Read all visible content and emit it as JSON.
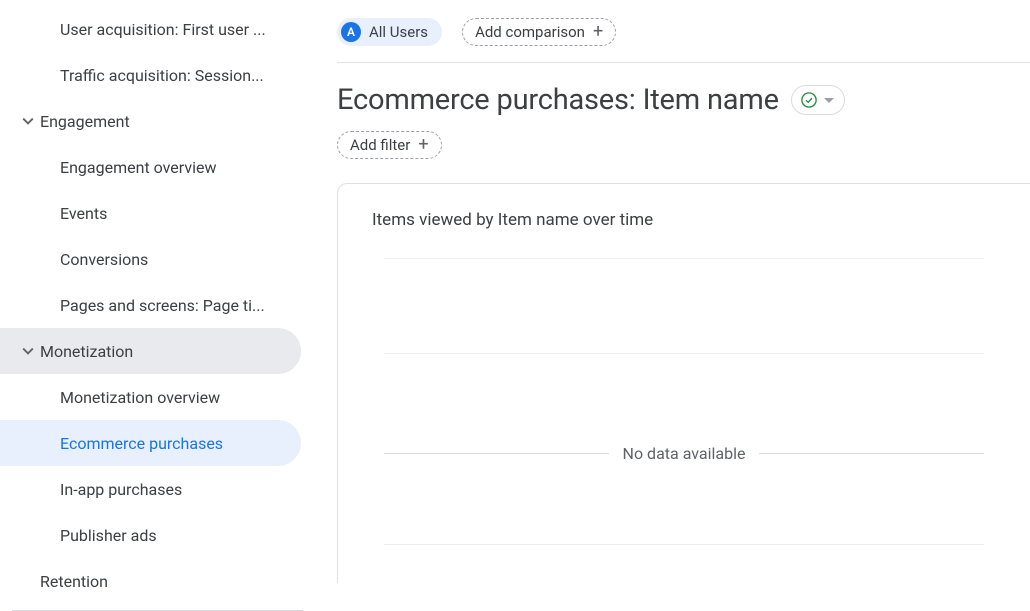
{
  "sidebar": {
    "items": [
      {
        "label": "User acquisition: First user ...",
        "level": 1
      },
      {
        "label": "Traffic acquisition: Session...",
        "level": 1
      },
      {
        "label": "Engagement",
        "level": 0,
        "expandable": true
      },
      {
        "label": "Engagement overview",
        "level": 1
      },
      {
        "label": "Events",
        "level": 1
      },
      {
        "label": "Conversions",
        "level": 1
      },
      {
        "label": "Pages and screens: Page ti...",
        "level": 1
      },
      {
        "label": "Monetization",
        "level": 0,
        "expandable": true,
        "sectionActive": true
      },
      {
        "label": "Monetization overview",
        "level": 1
      },
      {
        "label": "Ecommerce purchases",
        "level": 1,
        "active": true
      },
      {
        "label": "In-app purchases",
        "level": 1
      },
      {
        "label": "Publisher ads",
        "level": 1
      },
      {
        "label": "Retention",
        "level": 0
      }
    ]
  },
  "top": {
    "segment_badge": "A",
    "segment_label": "All Users",
    "add_comparison": "Add comparison"
  },
  "title": "Ecommerce purchases: Item name",
  "filters": {
    "add_filter": "Add filter"
  },
  "card": {
    "title": "Items viewed by Item name over time",
    "no_data": "No data available"
  }
}
